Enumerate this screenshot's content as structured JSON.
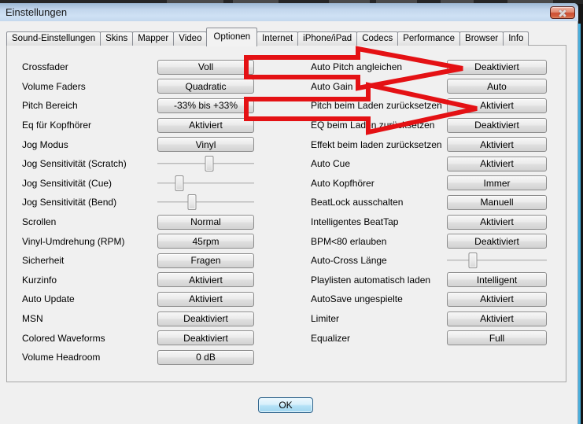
{
  "window": {
    "title": "Einstellungen"
  },
  "tabs": [
    "Sound-Einstellungen",
    "Skins",
    "Mapper",
    "Video",
    "Optionen",
    "Internet",
    "iPhone/iPad",
    "Codecs",
    "Performance",
    "Browser",
    "Info"
  ],
  "active_tab": "Optionen",
  "left_rows": [
    {
      "label": "Crossfader",
      "value": "Voll"
    },
    {
      "label": "Volume Faders",
      "value": "Quadratic"
    },
    {
      "label": "Pitch Bereich",
      "value": "-33% bis +33%"
    },
    {
      "label": "Eq für Kopfhörer",
      "value": "Aktiviert"
    },
    {
      "label": "Jog Modus",
      "value": "Vinyl"
    },
    {
      "label": "Jog Sensitivität (Scratch)",
      "thumb_left": "54%"
    },
    {
      "label": "Jog Sensitivität (Cue)",
      "thumb_left": "23%"
    },
    {
      "label": "Jog Sensitivität (Bend)",
      "thumb_left": "36%"
    },
    {
      "label": "Scrollen",
      "value": "Normal"
    },
    {
      "label": "Vinyl-Umdrehung (RPM)",
      "value": "45rpm"
    },
    {
      "label": "Sicherheit",
      "value": "Fragen"
    },
    {
      "label": "Kurzinfo",
      "value": "Aktiviert"
    },
    {
      "label": "Auto Update",
      "value": "Aktiviert"
    },
    {
      "label": "MSN",
      "value": "Deaktiviert"
    },
    {
      "label": "Colored Waveforms",
      "value": "Deaktiviert"
    },
    {
      "label": "Volume Headroom",
      "value": "0 dB"
    }
  ],
  "right_rows": [
    {
      "label": "Auto Pitch angleichen",
      "value": "Deaktiviert"
    },
    {
      "label": "Auto Gain",
      "value": "Auto"
    },
    {
      "label": "Pitch beim Laden zurücksetzen",
      "value": "Aktiviert"
    },
    {
      "label": "EQ beim Laden zurücksetzen",
      "value": "Deaktiviert"
    },
    {
      "label": "Effekt beim laden zurücksetzen",
      "value": "Aktiviert"
    },
    {
      "label": "Auto Cue",
      "value": "Aktiviert"
    },
    {
      "label": "Auto Kopfhörer",
      "value": "Immer"
    },
    {
      "label": "BeatLock ausschalten",
      "value": "Manuell"
    },
    {
      "label": "Intelligentes BeatTap",
      "value": "Aktiviert"
    },
    {
      "label": "BPM<80 erlauben",
      "value": "Deaktiviert"
    },
    {
      "label": "Auto-Cross Länge",
      "thumb_left": "26%"
    },
    {
      "label": "Playlisten automatisch laden",
      "value": "Intelligent"
    },
    {
      "label": "AutoSave ungespielte",
      "value": "Aktiviert"
    },
    {
      "label": "Limiter",
      "value": "Aktiviert"
    },
    {
      "label": "Equalizer",
      "value": "Full"
    }
  ],
  "footer": {
    "ok_label": "OK"
  },
  "annotations": {
    "arrow_1_target": "Auto Pitch angleichen / Deaktiviert",
    "arrow_2_target": "Pitch beim Laden zurücksetzen / Aktiviert"
  },
  "colors": {
    "arrow_red": "#e41114",
    "dialog_gray": "#f0f0f0",
    "titlebar_blue": "#c2d6ec",
    "ok_button_blue": "#b5e2f7",
    "close_button_red": "#cd4f33",
    "backdrop_glow_cyan": "#49b0dd"
  }
}
